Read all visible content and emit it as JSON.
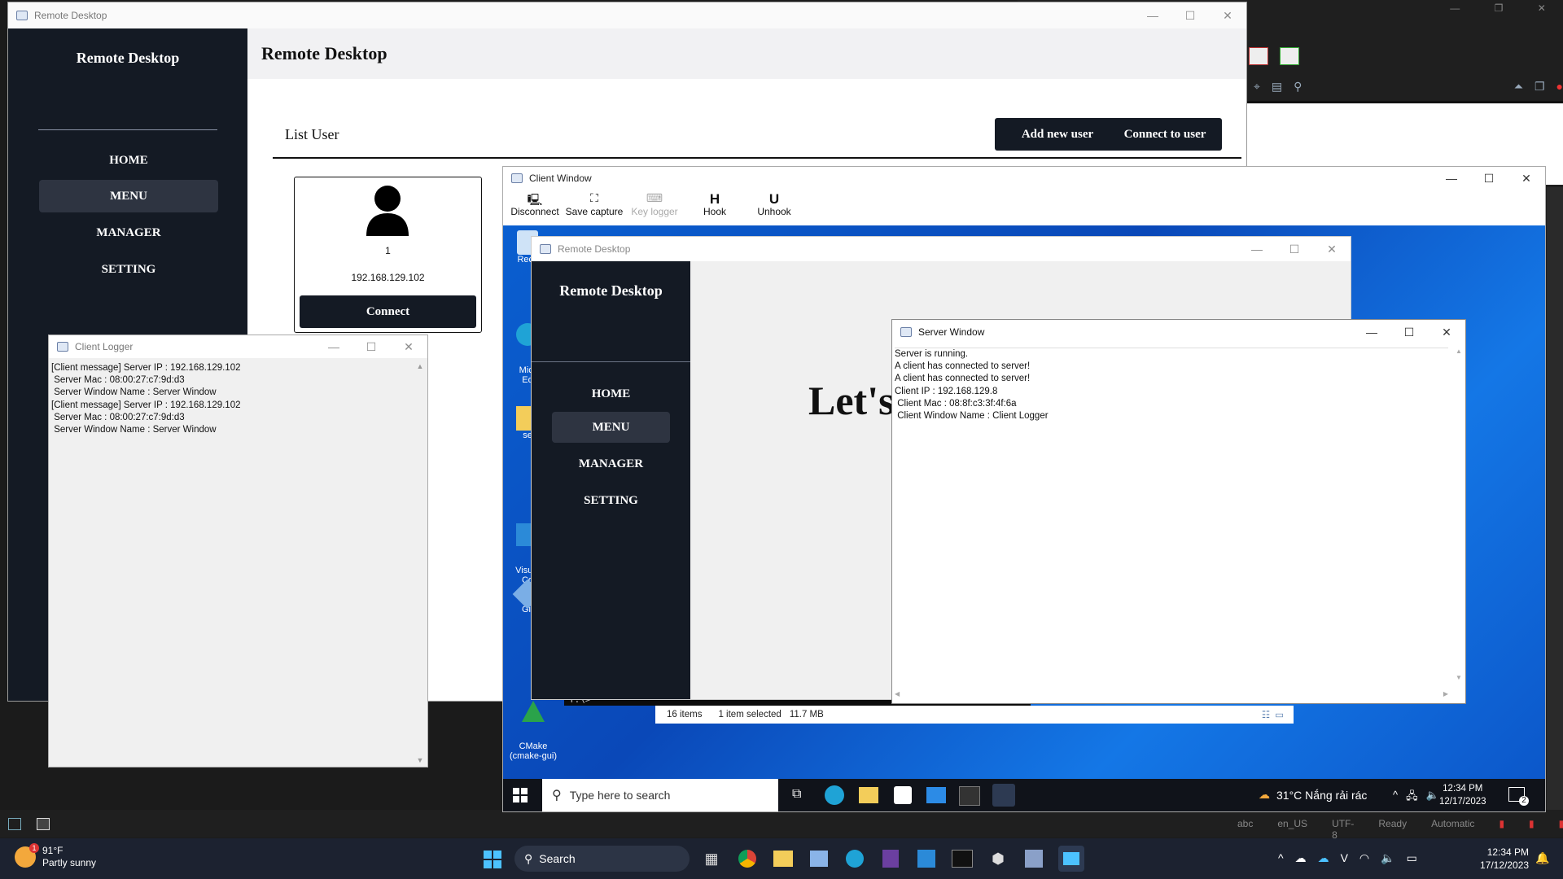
{
  "main_window": {
    "title": "Remote Desktop",
    "sidebar": {
      "title": "Remote Desktop",
      "items": [
        {
          "label": "HOME"
        },
        {
          "label": "MENU",
          "active": true
        },
        {
          "label": "MANAGER"
        },
        {
          "label": "SETTING"
        }
      ]
    },
    "header_title": "Remote Desktop",
    "section_title": "List User",
    "add_button": "Add new user",
    "connect_to_user_button": "Connect to user",
    "user_card": {
      "id": "1",
      "ip": "192.168.129.102",
      "connect_button": "Connect"
    }
  },
  "client_logger": {
    "title": "Client Logger",
    "lines": [
      "[Client message] Server IP : 192.168.129.102",
      " Server Mac : 08:00:27:c7:9d:d3",
      " Server Window Name : Server Window",
      "[Client message] Server IP : 192.168.129.102",
      " Server Mac : 08:00:27:c7:9d:d3",
      " Server Window Name : Server Window"
    ]
  },
  "client_window": {
    "title": "Client Window",
    "toolbar": [
      {
        "label": "Disconnect",
        "icon": "monitor-icon"
      },
      {
        "label": "Save capture",
        "icon": "capture-icon"
      },
      {
        "label": "Key logger",
        "icon": "keyboard-icon",
        "disabled": true
      },
      {
        "label": "Hook",
        "glyph": "H"
      },
      {
        "label": "Unhook",
        "glyph": "U"
      }
    ]
  },
  "inner_remote": {
    "title": "Remote Desktop",
    "sidebar_title": "Remote Desktop",
    "nav": [
      {
        "label": "HOME"
      },
      {
        "label": "MENU",
        "active": true
      },
      {
        "label": "MANAGER"
      },
      {
        "label": "SETTING"
      }
    ],
    "content_text": "Let's"
  },
  "remote_desktop_icons": [
    {
      "label": "Recy"
    },
    {
      "label": "Micr\nEd"
    },
    {
      "label": "se"
    },
    {
      "label": "Visual\nCo"
    },
    {
      "label": "Git"
    },
    {
      "label": "CMake\n(cmake-gui)"
    }
  ],
  "remote_terminal_prompt": "Y:\\>",
  "explorer_status": {
    "items": "16 items",
    "selected": "1 item selected",
    "size": "11.7 MB"
  },
  "remote_taskbar": {
    "search_placeholder": "Type here to search",
    "weather": "31°C  Nắng rải rác",
    "time": "12:34 PM",
    "date": "12/17/2023",
    "notification_count": "2"
  },
  "server_window": {
    "title": "Server Window",
    "lines": [
      "Server is running.",
      "A client has connected to server!",
      "A client has connected to server!",
      "Client IP : 192.168.129.8",
      " Client Mac : 08:8f:c3:3f:4f:6a",
      " Client Window Name : Client Logger"
    ]
  },
  "vscode_status": {
    "lang": "en_US",
    "encoding": "UTF-8",
    "ready": "Ready",
    "mode": "Automatic"
  },
  "host_taskbar": {
    "weather_temp": "91°F",
    "weather_desc": "Partly sunny",
    "weather_badge": "1",
    "search_label": "Search",
    "time": "12:34 PM",
    "date": "17/12/2023"
  }
}
